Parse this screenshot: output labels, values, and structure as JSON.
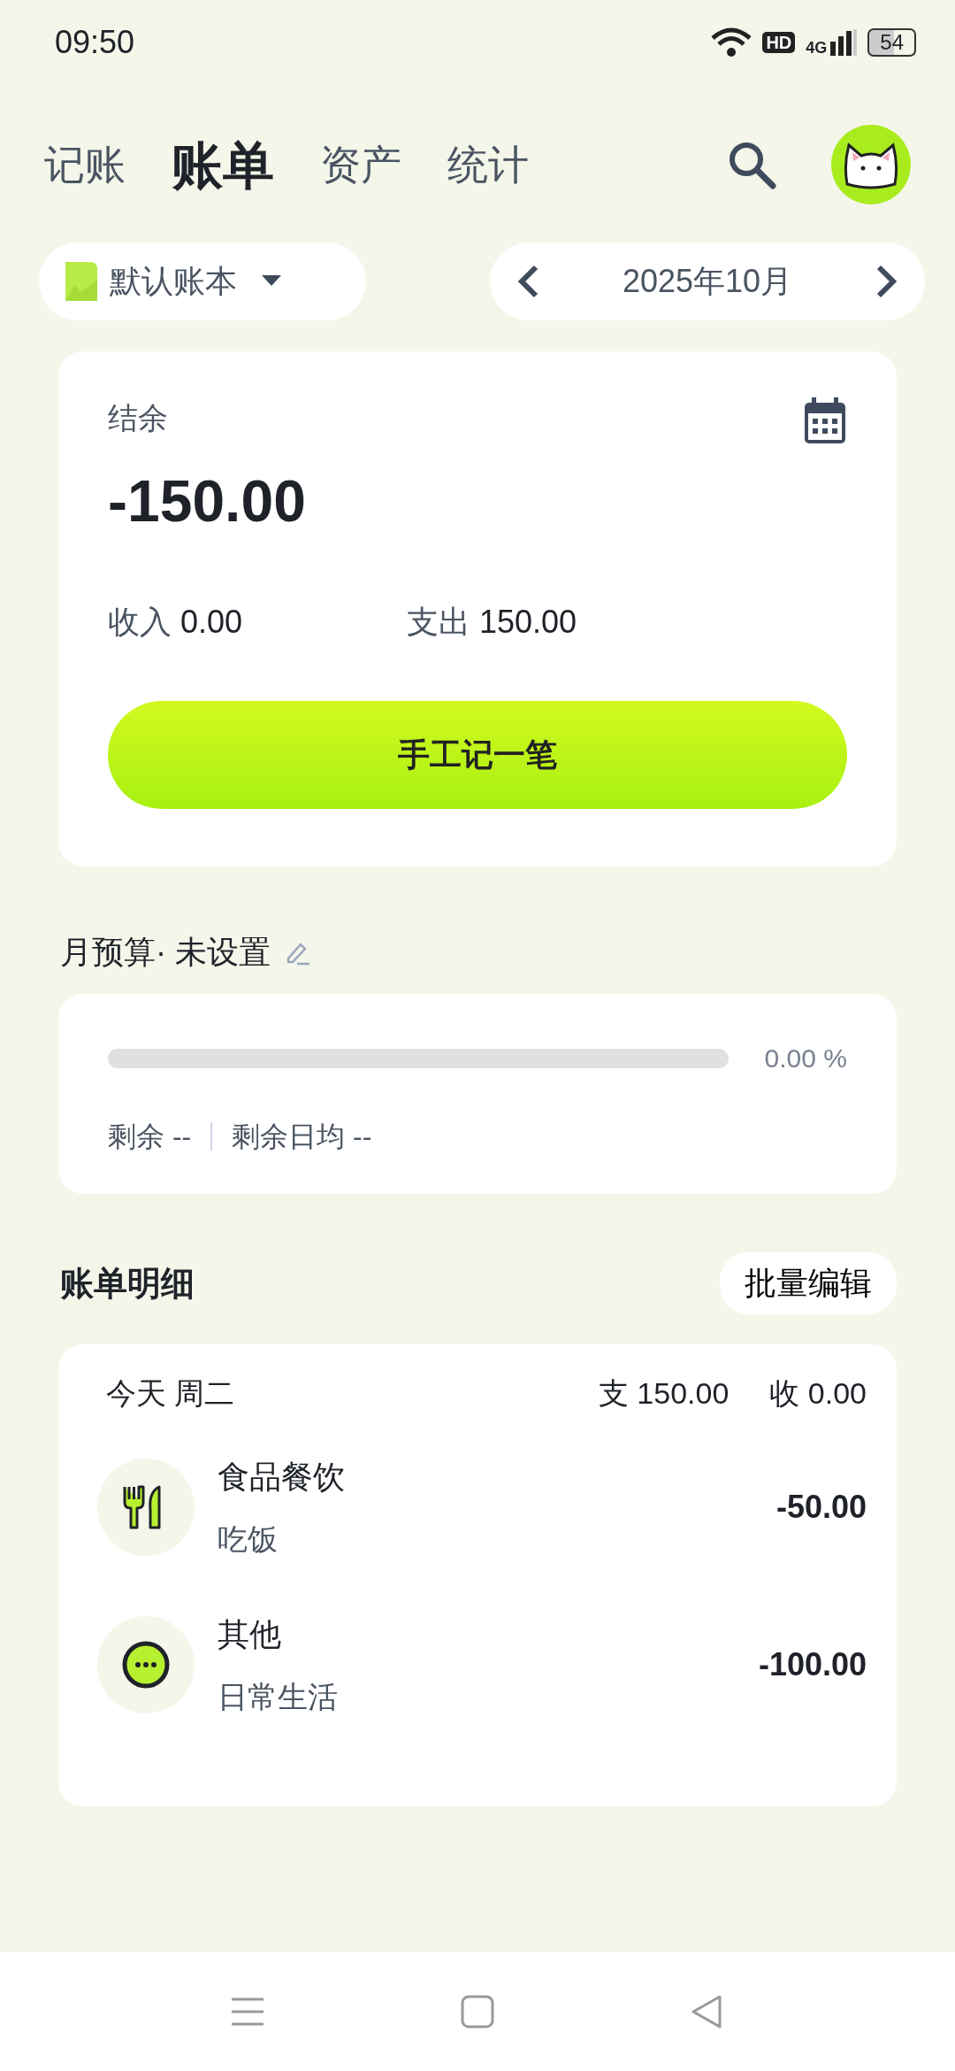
{
  "status_bar": {
    "time": "09:50",
    "hd": "HD",
    "network": "4G",
    "battery": "54"
  },
  "tabs": [
    {
      "label": "记账",
      "selected": false
    },
    {
      "label": "账单",
      "selected": true
    },
    {
      "label": "资产",
      "selected": false
    },
    {
      "label": "统计",
      "selected": false
    }
  ],
  "ledger": {
    "label": "默认账本"
  },
  "month": {
    "label": "2025年10月"
  },
  "summary": {
    "balance_label": "结余",
    "balance": "-150.00",
    "income_label": "收入",
    "income": "0.00",
    "expense_label": "支出",
    "expense": "150.00",
    "button": "手工记一笔"
  },
  "budget": {
    "title": "月预算· 未设置",
    "level": 0,
    "percent": "0.00 %",
    "remaining": "剩余 --",
    "daily": "剩余日均 --"
  },
  "details": {
    "title": "账单明细",
    "batch_button": "批量编辑"
  },
  "day": {
    "date": "今天 周二",
    "expense": "支 150.00",
    "income": "收 0.00",
    "items": [
      {
        "kind": "food",
        "category": "食品餐饮",
        "note": "吃饭",
        "amount": "-50.00"
      },
      {
        "kind": "other",
        "category": "其他",
        "note": "日常生活",
        "amount": "-100.00"
      }
    ]
  }
}
